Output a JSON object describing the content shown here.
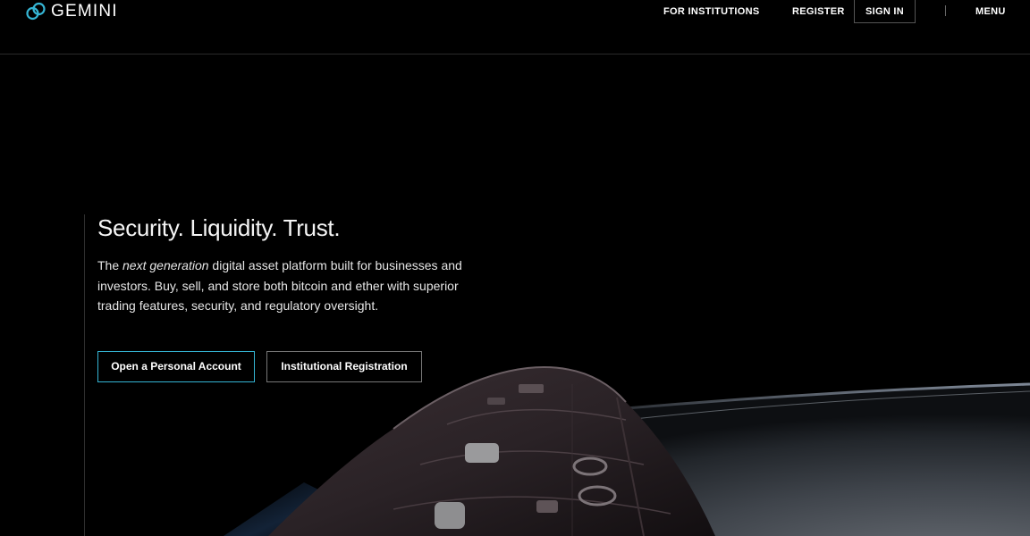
{
  "brand": {
    "name": "GEMINI",
    "logo_icon": "gemini-logo-icon",
    "accent_color": "#35b5d4"
  },
  "nav": {
    "institutions": "FOR INSTITUTIONS",
    "register": "REGISTER",
    "sign_in": "SIGN IN",
    "menu": "MENU"
  },
  "hero": {
    "title": "Security. Liquidity. Trust.",
    "desc_prefix": "The ",
    "desc_emphasis": "next generation",
    "desc_suffix": " digital asset platform built for businesses and investors. Buy, sell, and store both bitcoin and ether with superior trading features, security, and regulatory oversight.",
    "primary_button": "Open a Personal Account",
    "secondary_button": "Institutional Registration"
  },
  "background": {
    "image": "spacecraft-over-earth-horizon"
  }
}
